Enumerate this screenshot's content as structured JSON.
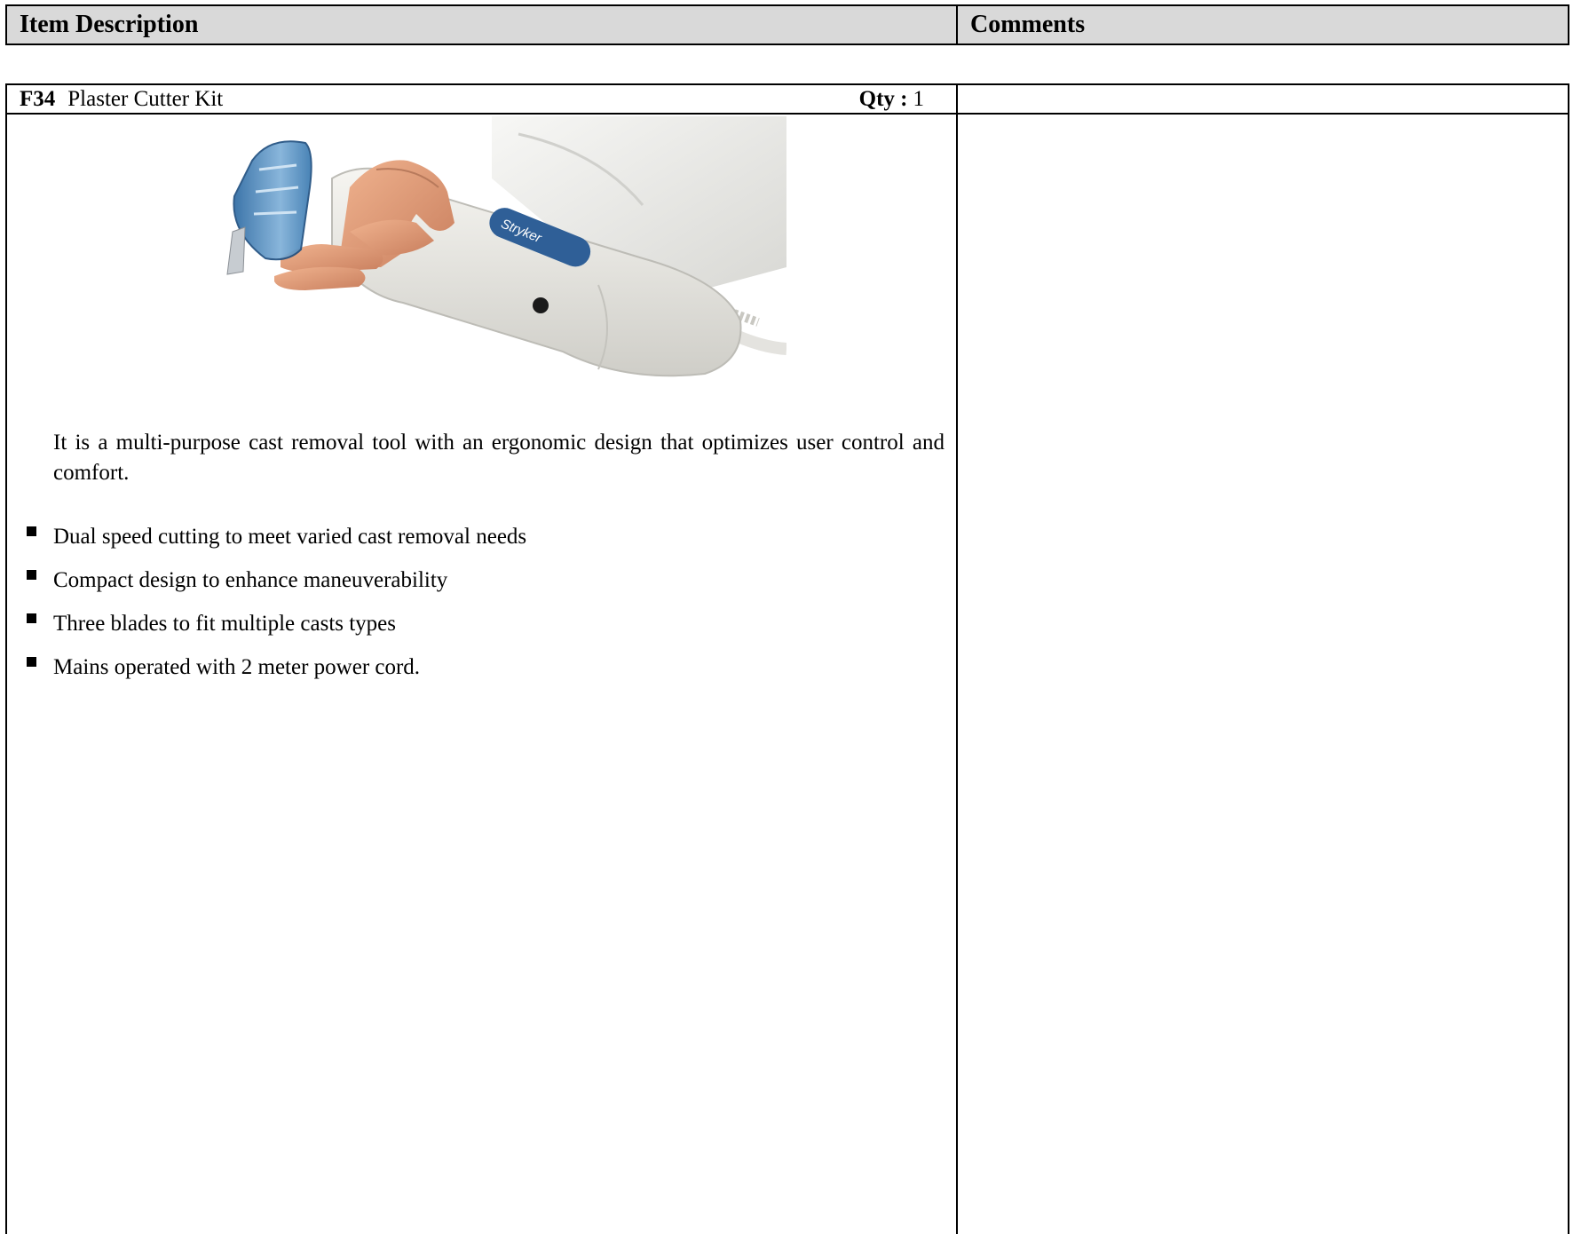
{
  "header": {
    "item_description": "Item Description",
    "comments": "Comments"
  },
  "item": {
    "code": "F34",
    "name": "Plaster Cutter Kit",
    "qty_label": "Qty :",
    "qty_value": "1",
    "image_brand": "Stryker",
    "description": "It is a multi-purpose cast removal tool with an ergonomic design that optimizes user control and comfort.",
    "features": [
      "Dual speed cutting to meet varied cast removal needs",
      "Compact design to enhance maneuverability",
      "Three blades to fit multiple casts types",
      "Mains operated with 2 meter power cord."
    ],
    "comments": ""
  },
  "colors": {
    "header_bg": "#d9d9d9",
    "border": "#000000",
    "tool_body": "#ecebe6",
    "blade_guard_blue": "#4a86b8",
    "brand_label_blue": "#2f5f97"
  }
}
